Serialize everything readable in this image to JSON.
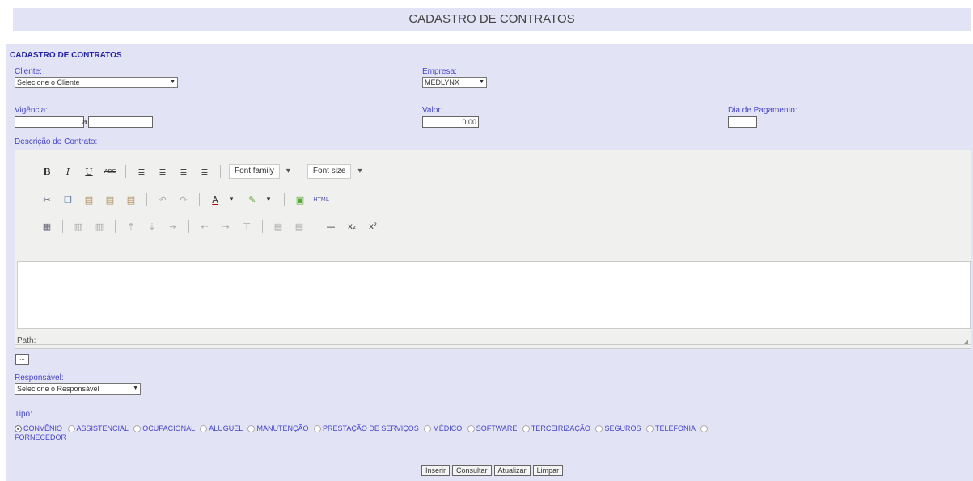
{
  "banner_title": "CADASTRO DE CONTRATOS",
  "section_title": "CADASTRO DE CONTRATOS",
  "fields": {
    "cliente": {
      "label": "Cliente:",
      "value": "Selecione o Cliente"
    },
    "empresa": {
      "label": "Empresa:",
      "value": "MEDLYNX"
    },
    "vigencia": {
      "label": "Vigência:",
      "separator": "a"
    },
    "valor": {
      "label": "Valor:",
      "value": "0,00"
    },
    "dia_pagamento": {
      "label": "Dia de Pagamento:"
    },
    "descricao": {
      "label": "Descrição do Contrato:"
    },
    "responsavel": {
      "label": "Responsável:",
      "value": "Selecione o Responsável"
    },
    "tipo": {
      "label": "Tipo:"
    }
  },
  "editor": {
    "font_family": "Font family",
    "font_size": "Font size",
    "path_label": "Path:",
    "small_button": "..."
  },
  "tipos": [
    {
      "label": "CONVÊNIO",
      "selected": true
    },
    {
      "label": "ASSISTENCIAL",
      "selected": false
    },
    {
      "label": "OCUPACIONAL",
      "selected": false
    },
    {
      "label": "ALUGUEL",
      "selected": false
    },
    {
      "label": "MANUTENÇÃO",
      "selected": false
    },
    {
      "label": "PRESTAÇÃO DE SERVIÇOS",
      "selected": false
    },
    {
      "label": "MÉDICO",
      "selected": false
    },
    {
      "label": "SOFTWARE",
      "selected": false
    },
    {
      "label": "TERCEIRIZAÇÃO",
      "selected": false
    },
    {
      "label": "SEGUROS",
      "selected": false
    },
    {
      "label": "TELEFONIA",
      "selected": false
    },
    {
      "label": "FORNECEDOR",
      "selected": false
    }
  ],
  "buttons": {
    "inserir": "Inserir",
    "consultar": "Consultar",
    "atualizar": "Atualizar",
    "limpar": "Limpar"
  }
}
